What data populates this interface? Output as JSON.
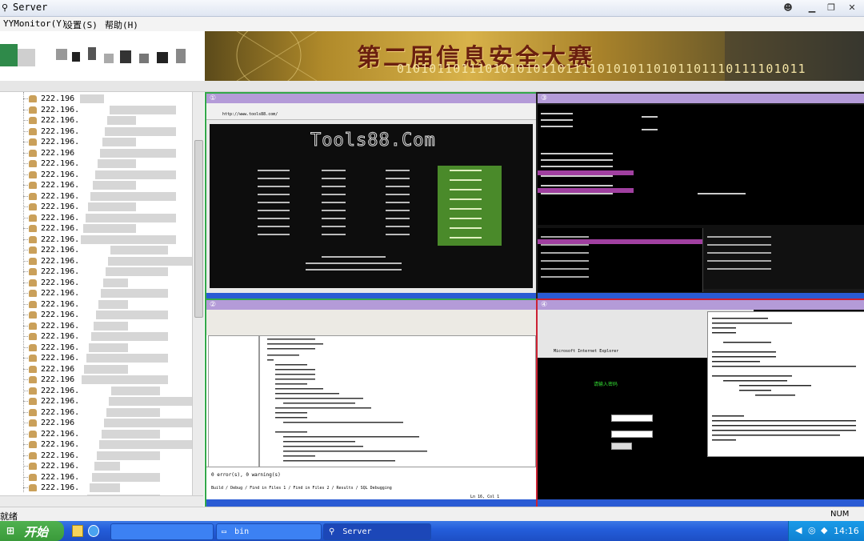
{
  "window": {
    "title": "Server"
  },
  "menu": {
    "items": [
      "YYMonitor(Y)",
      "设置(S)",
      "帮助(H)"
    ]
  },
  "banner": {
    "title": "第二届信息安全大赛",
    "binary": "010101101110101010110111101010110101101110111101011"
  },
  "tree": {
    "prefix": "222.196.",
    "rows": [
      "222.196",
      "222.196.",
      "222.196.",
      "222.196.",
      "222.196.",
      "222.196",
      "222.196.",
      "222.196.",
      "222.196.",
      "222.196.",
      "222.196.",
      "222.196.",
      "222.196.",
      "222.196.",
      "222.196.",
      "222.196.",
      "222.196.",
      "222.196.",
      "222.196.",
      "222.196.",
      "222.196.",
      "222.196.",
      "222.196.",
      "222.196.",
      "222.196.",
      "222.196",
      "222.196",
      "222.196.",
      "222.196.",
      "222.196.",
      "222.196",
      "222.196.",
      "222.196.",
      "222.196.",
      "222.196.",
      "222.196.",
      "222.196.",
      "222.196."
    ]
  },
  "panes": [
    {
      "id": "①",
      "site": "Tools88.Com",
      "url": "http://www.tools88.com/"
    },
    {
      "id": "②",
      "label": "Build / Debug / Find in Files 1 / Find in Files 2 / Results / SQL Debugging",
      "status": "Ln 16, Col 1",
      "errors": "0 error(s), 0 warning(s)"
    },
    {
      "id": "③",
      "label": "Registers / Hex dump / Stack"
    },
    {
      "id": "④",
      "label": "Microsoft Internet Explorer",
      "prompt": "请输入密码"
    }
  ],
  "statusbar": {
    "left": "就绪",
    "right": "NUM"
  },
  "taskbar": {
    "start": "开始",
    "items": [
      "bin",
      "Server"
    ],
    "clock": "14:16"
  },
  "colors": {
    "taskbar": "#245edb",
    "start": "#3a9a3a",
    "pane_active": "#33a84a",
    "pane_alert": "#cc2233"
  }
}
